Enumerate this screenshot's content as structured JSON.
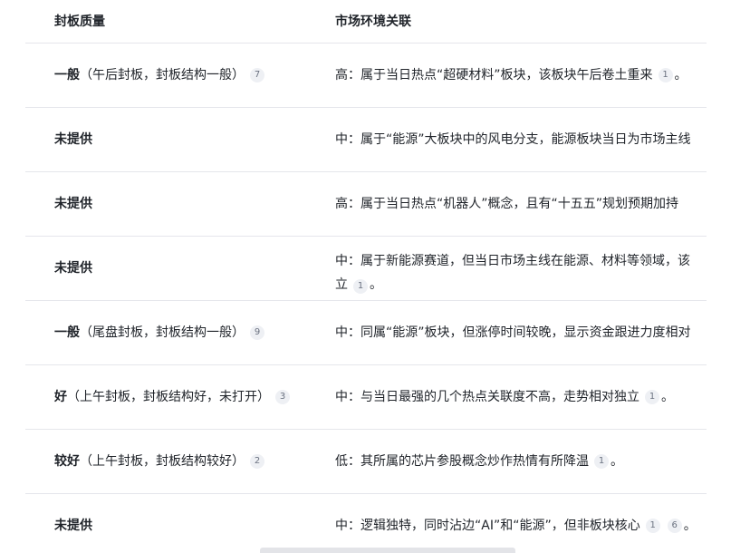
{
  "header": {
    "col1": "封板质量",
    "col2": "市场环境关联"
  },
  "rows": [
    {
      "quality": "一般",
      "note": "（午后封板，封板结构一般）",
      "quality_cite": "7",
      "env": "高：属于当日热点“超硬材料”板块，该板块午后卷土重来",
      "env_cites": [
        "1"
      ],
      "env_tail": "。"
    },
    {
      "quality": "未提供",
      "env": "中：属于“能源”大板块中的风电分支，能源板块当日为市场主线"
    },
    {
      "quality": "未提供",
      "env": "高：属于当日热点“机器人”概念，且有“十五五”规划预期加持"
    },
    {
      "quality": "未提供",
      "env_line1": "中：属于新能源赛道，但当日市场主线在能源、材料等领域，该",
      "env_line2": "立",
      "env_cites": [
        "1"
      ],
      "env_tail": "。"
    },
    {
      "quality": "一般",
      "note": "（尾盘封板，封板结构一般）",
      "quality_cite": "9",
      "env": "中：同属“能源”板块，但涨停时间较晚，显示资金跟进力度相对"
    },
    {
      "quality": "好",
      "note": "（上午封板，封板结构好，未打开）",
      "quality_cite": "3",
      "env": "中：与当日最强的几个热点关联度不高，走势相对独立",
      "env_cites": [
        "1"
      ],
      "env_tail": "。"
    },
    {
      "quality": "较好",
      "note": "（上午封板，封板结构较好）",
      "quality_cite": "2",
      "env": "低：其所属的芯片参股概念炒作热情有所降温",
      "env_cites": [
        "1"
      ],
      "env_tail": "。"
    },
    {
      "quality": "未提供",
      "env": "中：逻辑独特，同时沾边“AI”和“能源”，但非板块核心",
      "env_cites": [
        "1",
        "6"
      ],
      "env_tail": "。"
    }
  ]
}
